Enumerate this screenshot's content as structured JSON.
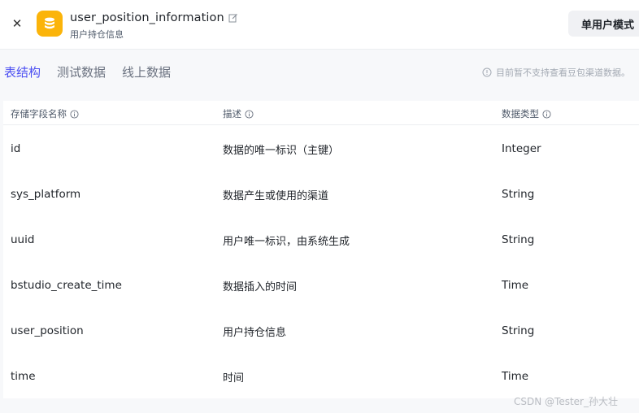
{
  "header": {
    "close_icon": "close-icon",
    "app_icon": "database-icon",
    "app_icon_color": "#fbb40a",
    "title": "user_position_information",
    "subtitle": "用户持仓信息",
    "mode_button": "单用户模式"
  },
  "tabs": [
    {
      "label": "表结构",
      "active": true
    },
    {
      "label": "测试数据",
      "active": false
    },
    {
      "label": "线上数据",
      "active": false
    }
  ],
  "notice": "目前暂不支持查看豆包渠道数据。",
  "table": {
    "columns": [
      "存储字段名称",
      "描述",
      "数据类型"
    ],
    "rows": [
      {
        "field": "id",
        "desc": "数据的唯一标识（主键）",
        "type": "Integer"
      },
      {
        "field": "sys_platform",
        "desc": "数据产生或使用的渠道",
        "type": "String"
      },
      {
        "field": "uuid",
        "desc": "用户唯一标识，由系统生成",
        "type": "String"
      },
      {
        "field": "bstudio_create_time",
        "desc": "数据插入的时间",
        "type": "Time"
      },
      {
        "field": "user_position",
        "desc": "用户持仓信息",
        "type": "String"
      },
      {
        "field": "time",
        "desc": "时间",
        "type": "Time"
      }
    ]
  },
  "accent_color": "#4c4ff2",
  "watermark": "CSDN @Tester_孙大壮"
}
